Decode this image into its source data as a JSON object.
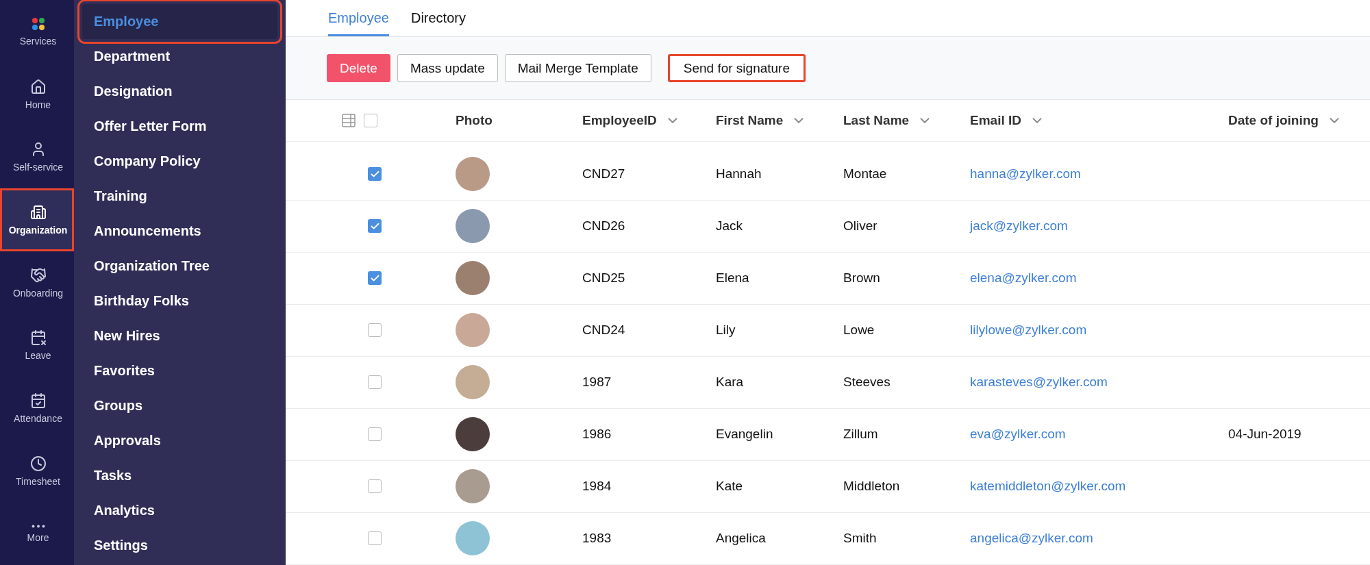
{
  "rail": [
    {
      "label": "Services",
      "selected": false,
      "highlighted": false
    },
    {
      "label": "Home",
      "selected": false,
      "highlighted": false
    },
    {
      "label": "Self-service",
      "selected": false,
      "highlighted": false
    },
    {
      "label": "Organization",
      "selected": true,
      "highlighted": true
    },
    {
      "label": "Onboarding",
      "selected": false,
      "highlighted": false
    },
    {
      "label": "Leave",
      "selected": false,
      "highlighted": false
    },
    {
      "label": "Attendance",
      "selected": false,
      "highlighted": false
    },
    {
      "label": "Timesheet",
      "selected": false,
      "highlighted": false
    },
    {
      "label": "More",
      "selected": false,
      "highlighted": false
    }
  ],
  "sidebar": {
    "items": [
      {
        "label": "Employee",
        "selected": true,
        "highlighted": true
      },
      {
        "label": "Department",
        "selected": false,
        "highlighted": false
      },
      {
        "label": "Designation",
        "selected": false,
        "highlighted": false
      },
      {
        "label": "Offer Letter Form",
        "selected": false,
        "highlighted": false
      },
      {
        "label": "Company Policy",
        "selected": false,
        "highlighted": false
      },
      {
        "label": "Training",
        "selected": false,
        "highlighted": false
      },
      {
        "label": "Announcements",
        "selected": false,
        "highlighted": false
      },
      {
        "label": "Organization Tree",
        "selected": false,
        "highlighted": false
      },
      {
        "label": "Birthday Folks",
        "selected": false,
        "highlighted": false
      },
      {
        "label": "New Hires",
        "selected": false,
        "highlighted": false
      },
      {
        "label": "Favorites",
        "selected": false,
        "highlighted": false
      },
      {
        "label": "Groups",
        "selected": false,
        "highlighted": false
      },
      {
        "label": "Approvals",
        "selected": false,
        "highlighted": false
      },
      {
        "label": "Tasks",
        "selected": false,
        "highlighted": false
      },
      {
        "label": "Analytics",
        "selected": false,
        "highlighted": false
      },
      {
        "label": "Settings",
        "selected": false,
        "highlighted": false
      }
    ]
  },
  "tabs": [
    {
      "label": "Employee",
      "selected": true
    },
    {
      "label": "Directory",
      "selected": false
    }
  ],
  "toolbar": [
    {
      "label": "Delete",
      "kind": "danger",
      "highlighted": false
    },
    {
      "label": "Mass update",
      "kind": "plain",
      "highlighted": false
    },
    {
      "label": "Mail Merge Template",
      "kind": "plain",
      "highlighted": false
    },
    {
      "label": "Send for signature",
      "kind": "plain",
      "highlighted": true
    }
  ],
  "table": {
    "select_all": {
      "checked": false
    },
    "columns": [
      {
        "label": "Photo",
        "sortable": false
      },
      {
        "label": "EmployeeID",
        "sortable": true
      },
      {
        "label": "First Name",
        "sortable": true
      },
      {
        "label": "Last Name",
        "sortable": true
      },
      {
        "label": "Email ID",
        "sortable": true
      },
      {
        "label": "Date of joining",
        "sortable": true
      }
    ],
    "rows": [
      {
        "checked": true,
        "id": "CND27",
        "first": "Hannah",
        "last": "Montae",
        "email": "hanna@zylker.com"
      },
      {
        "checked": true,
        "id": "CND26",
        "first": "Jack",
        "last": "Oliver",
        "email": "jack@zylker.com"
      },
      {
        "checked": true,
        "id": "CND25",
        "first": "Elena",
        "last": "Brown",
        "email": "elena@zylker.com"
      },
      {
        "checked": false,
        "id": "CND24",
        "first": "Lily",
        "last": "Lowe",
        "email": "lilylowe@zylker.com"
      },
      {
        "checked": false,
        "id": "1987",
        "first": "Kara",
        "last": "Steeves",
        "email": "karasteves@zylker.com"
      },
      {
        "checked": false,
        "id": "1986",
        "first": "Evangelin",
        "last": "Zillum",
        "email": "eva@zylker.com",
        "date": "04-Jun-2019"
      },
      {
        "checked": false,
        "id": "1984",
        "first": "Kate",
        "last": "Middleton",
        "email": "katemiddleton@zylker.com"
      },
      {
        "checked": false,
        "id": "1983",
        "first": "Angelica",
        "last": "Smith",
        "email": "angelica@zylker.com"
      }
    ]
  }
}
